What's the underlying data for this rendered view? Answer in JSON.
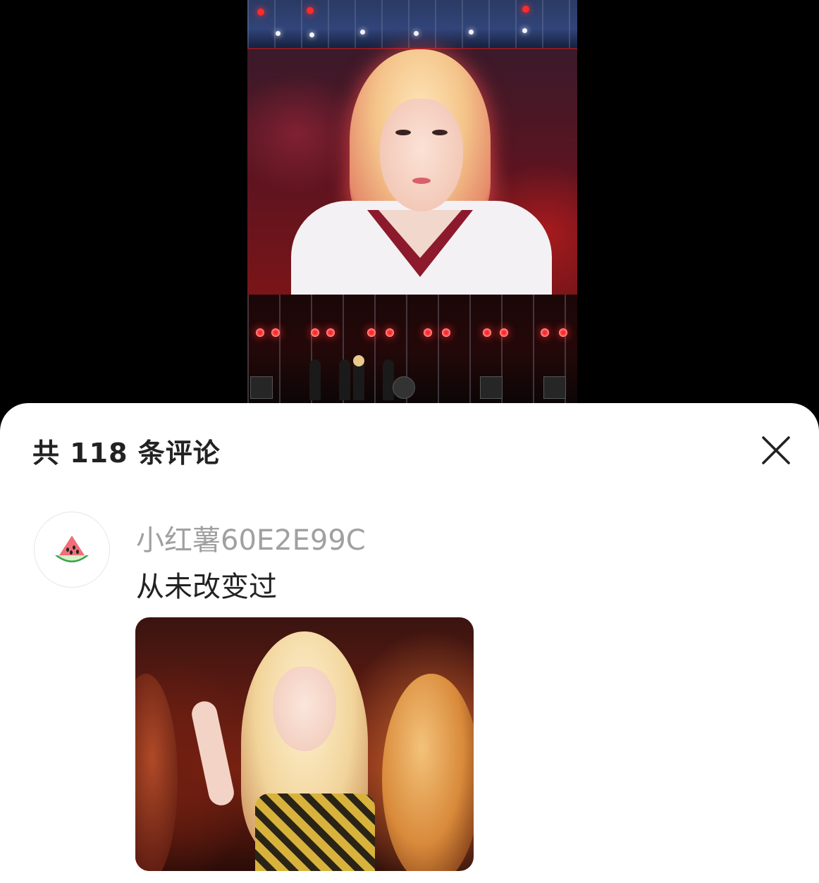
{
  "post": {
    "photo_description_icon": "concert-photo"
  },
  "comments_sheet": {
    "title": "共 118 条评论",
    "close_icon": "close-icon"
  },
  "comments": [
    {
      "avatar_icon": "watermelon-icon",
      "username": "小红薯60E2E99C",
      "text": "从未改变过",
      "image_icon": "performer-photo"
    }
  ]
}
